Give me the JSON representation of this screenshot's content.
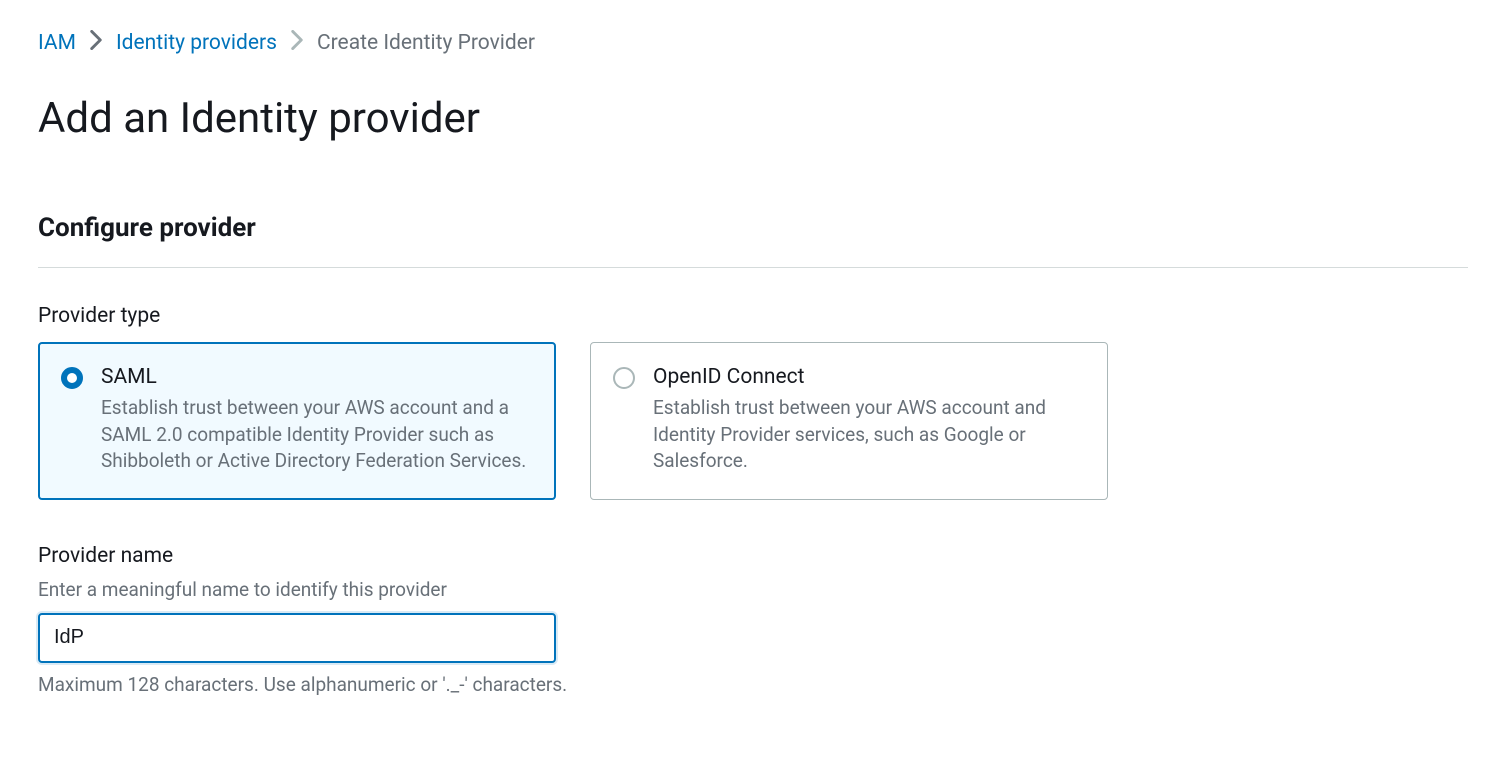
{
  "breadcrumb": {
    "items": [
      "IAM",
      "Identity providers",
      "Create Identity Provider"
    ]
  },
  "page": {
    "title": "Add an Identity provider"
  },
  "section": {
    "title": "Configure provider"
  },
  "provider_type": {
    "label": "Provider type",
    "options": [
      {
        "title": "SAML",
        "desc": "Establish trust between your AWS account and a SAML 2.0 compatible Identity Provider such as Shibboleth or Active Directory Federation Services.",
        "selected": true
      },
      {
        "title": "OpenID Connect",
        "desc": "Establish trust between your AWS account and Identity Provider services, such as Google or Salesforce.",
        "selected": false
      }
    ]
  },
  "provider_name": {
    "label": "Provider name",
    "hint_top": "Enter a meaningful name to identify this provider",
    "value": "IdP",
    "hint_bottom": "Maximum 128 characters. Use alphanumeric or '._-' characters."
  }
}
